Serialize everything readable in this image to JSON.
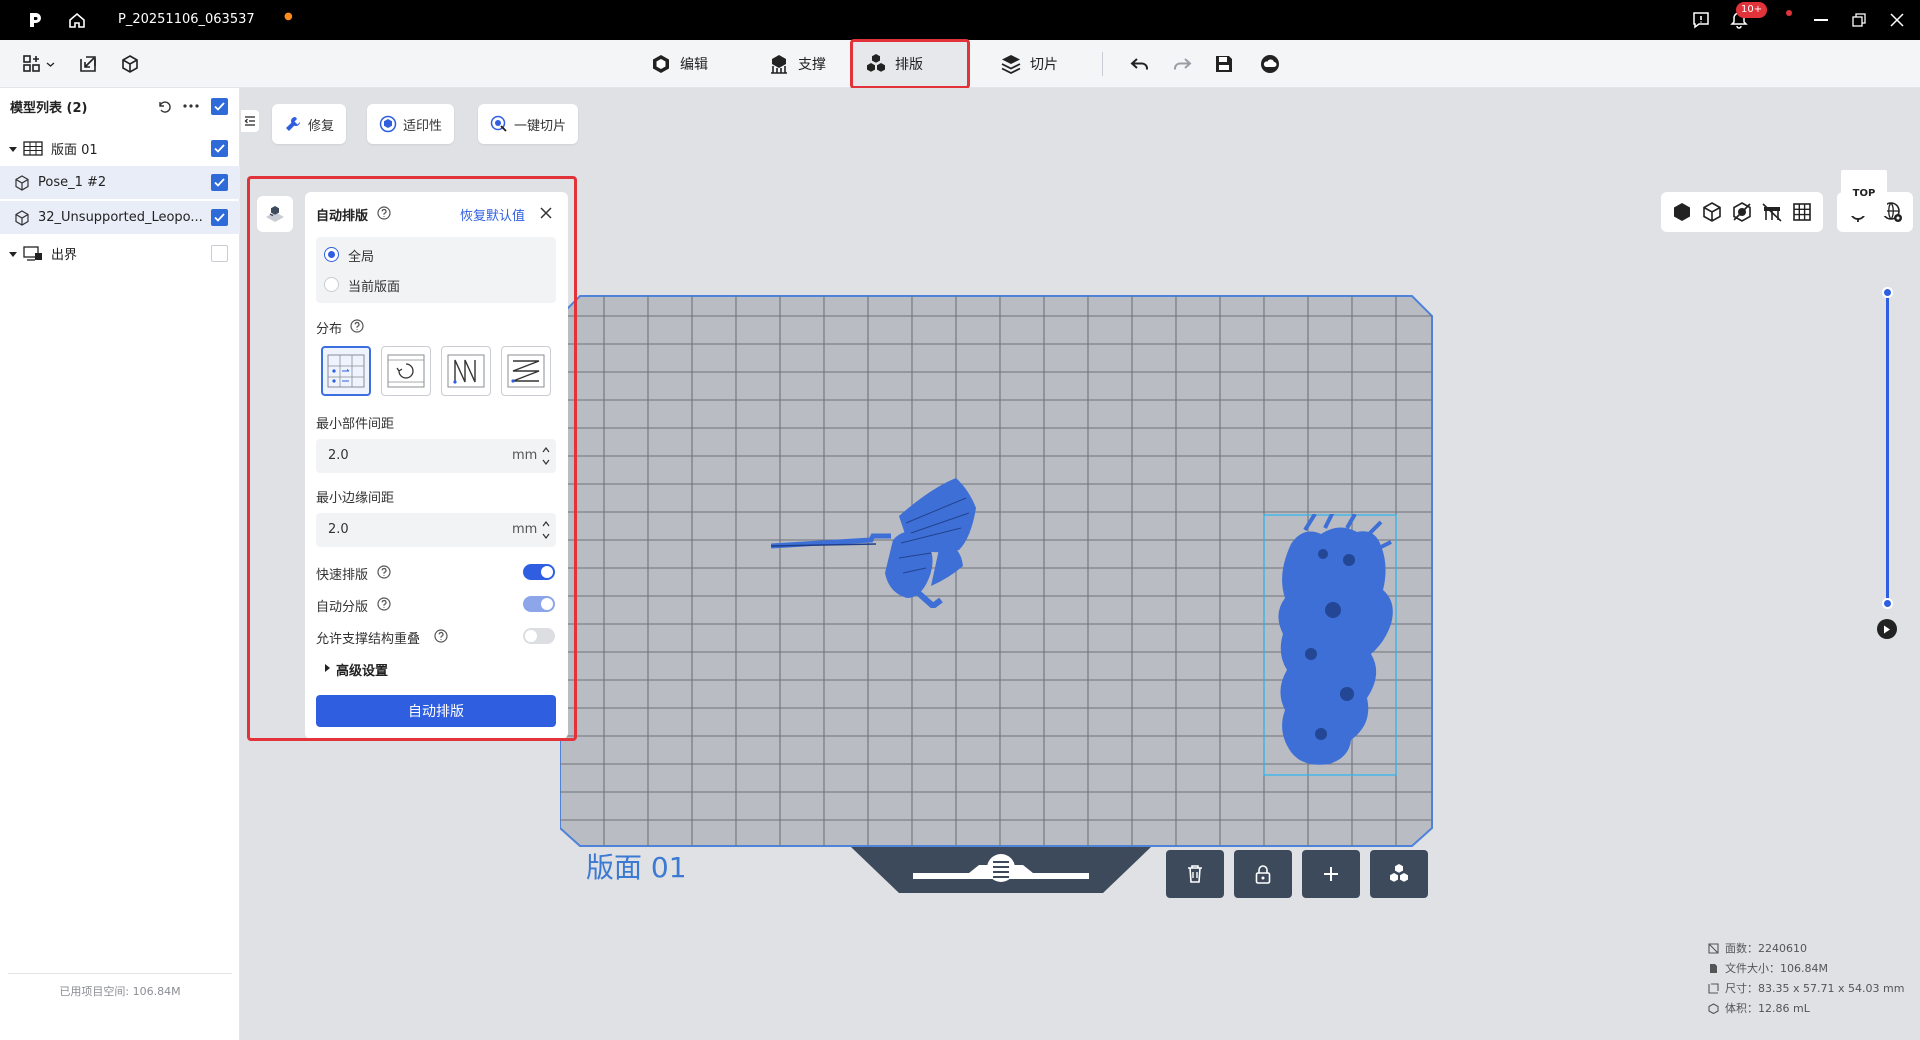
{
  "titlebar": {
    "project_name": "P_20251106_063537",
    "unsaved_dot": "●",
    "notification_badge": "10+"
  },
  "toolbar": {
    "tabs": [
      {
        "label": "编辑",
        "icon": "cube-icon"
      },
      {
        "label": "支撑",
        "icon": "support-icon"
      },
      {
        "label": "排版",
        "icon": "layout-icon",
        "active": true
      },
      {
        "label": "切片",
        "icon": "layers-icon"
      }
    ]
  },
  "sidebar": {
    "header": "模型列表 (2)",
    "plate": "版面 01",
    "models": [
      "Pose_1 #2",
      "32_Unsupported_Leopo..."
    ],
    "out_of_bounds": "出界",
    "footer": "已用项目空间: 106.84M"
  },
  "viewport_tools": {
    "repair": "修复",
    "printability": "适印性",
    "one_click_slice": "一键切片",
    "view_label": "TOP",
    "plate_label": "版面 01"
  },
  "arrange_panel": {
    "title": "自动排版",
    "reset": "恢复默认值",
    "scope_global": "全局",
    "scope_current": "当前版面",
    "distribution": "分布",
    "min_part_spacing_label": "最小部件间距",
    "min_part_spacing": "2.0",
    "min_edge_spacing_label": "最小边缘间距",
    "min_edge_spacing": "2.0",
    "unit": "mm",
    "fast_arrange": "快速排版",
    "auto_split": "自动分版",
    "allow_support_overlap": "允许支撑结构重叠",
    "advanced": "高级设置",
    "submit": "自动排版"
  },
  "stats": {
    "faces": "面数：2240610",
    "file_size": "文件大小：106.84M",
    "dimensions": "尺寸：83.35 x 57.71 x 54.03 mm",
    "volume": "体积：12.86 mL"
  },
  "colors": {
    "accent": "#2f5fe0",
    "highlight": "#e2333a",
    "model": "#3d6fd6",
    "plate": "#b9bcc2"
  }
}
